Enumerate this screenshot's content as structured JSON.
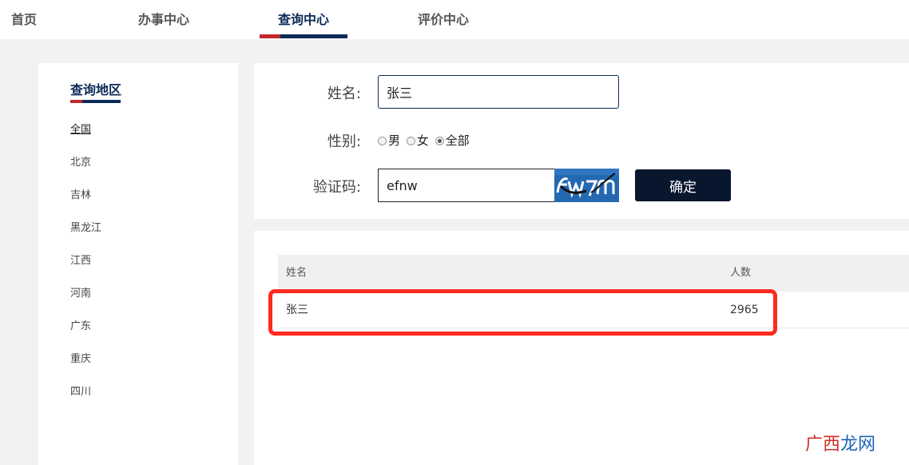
{
  "nav": {
    "items": [
      {
        "label": "首页",
        "active": false
      },
      {
        "label": "办事中心",
        "active": false
      },
      {
        "label": "查询中心",
        "active": true
      },
      {
        "label": "评价中心",
        "active": false
      }
    ]
  },
  "sidebar": {
    "title": "查询地区",
    "regions": [
      "全国",
      "北京",
      "吉林",
      "黑龙江",
      "江西",
      "河南",
      "广东",
      "重庆",
      "四川"
    ],
    "selected": "全国"
  },
  "form": {
    "name_label": "姓名:",
    "name_value": "张三",
    "gender_label": "性别:",
    "gender_options": [
      "男",
      "女",
      "全部"
    ],
    "gender_selected": "全部",
    "captcha_label": "验证码:",
    "captcha_value": "efnw",
    "submit_label": "确定"
  },
  "results": {
    "headers": {
      "name": "姓名",
      "count": "人数"
    },
    "rows": [
      {
        "name": "张三",
        "count": "2965"
      }
    ]
  },
  "colors": {
    "brand_navy": "#0b2a57",
    "accent_red": "#c1272d",
    "highlight": "#ff2a1f"
  }
}
